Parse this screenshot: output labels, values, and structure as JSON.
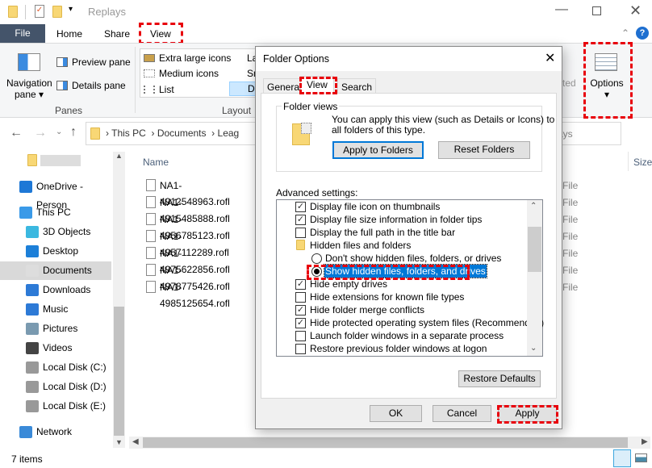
{
  "window": {
    "title": "Replays"
  },
  "ribbon": {
    "tabs": [
      "File",
      "Home",
      "Share",
      "View"
    ],
    "panes": {
      "navigation_pane": "Navigation",
      "navigation_pane2": "pane",
      "preview_pane": "Preview pane",
      "details_pane": "Details pane",
      "group_label": "Panes"
    },
    "layout": {
      "items": [
        "Extra large icons",
        "Medium icons",
        "List",
        "La",
        "Sm",
        "De"
      ],
      "group_label": "Layout"
    },
    "selected_fragment": "ted",
    "options": "Options"
  },
  "address": {
    "crumbs": [
      "This PC",
      "Documents",
      "Leag"
    ],
    "search_fragment": "ays"
  },
  "nav": {
    "items": [
      "OneDrive - Person",
      "This PC",
      "3D Objects",
      "Desktop",
      "Documents",
      "Downloads",
      "Music",
      "Pictures",
      "Videos",
      "Local Disk (C:)",
      "Local Disk (D:)",
      "Local Disk (E:)",
      "Network"
    ],
    "selected": "Documents"
  },
  "files": {
    "header_name": "Name",
    "header_size": "Size",
    "type_fragment": "File",
    "items": [
      "NA1-4912548963.rofl",
      "NA1-4915485888.rofl",
      "NA1-4956785123.rofl",
      "NA1-4957112289.rofl",
      "NA1-4975622856.rofl",
      "NA1-4978775426.rofl",
      "NA1-4985125654.rofl"
    ]
  },
  "status": {
    "count": "7 items"
  },
  "dialog": {
    "title": "Folder Options",
    "tabs": [
      "General",
      "View",
      "Search"
    ],
    "active_tab": "View",
    "folder_views": {
      "label": "Folder views",
      "text1": "You can apply this view (such as Details or Icons) to",
      "text2": "all folders of this type.",
      "apply": "Apply to Folders",
      "reset": "Reset Folders"
    },
    "advanced_label": "Advanced settings:",
    "settings": [
      {
        "label": "Display file icon on thumbnails",
        "type": "check",
        "checked": true
      },
      {
        "label": "Display file size information in folder tips",
        "type": "check",
        "checked": true
      },
      {
        "label": "Display the full path in the title bar",
        "type": "check",
        "checked": false
      },
      {
        "label": "Hidden files and folders",
        "type": "folder"
      },
      {
        "label": "Don't show hidden files, folders, or drives",
        "type": "radio",
        "checked": false
      },
      {
        "label": "Show hidden files, folders, and drives",
        "type": "radio",
        "checked": true
      },
      {
        "label": "Hide empty drives",
        "type": "check",
        "checked": true
      },
      {
        "label": "Hide extensions for known file types",
        "type": "check",
        "checked": false
      },
      {
        "label": "Hide folder merge conflicts",
        "type": "check",
        "checked": true
      },
      {
        "label": "Hide protected operating system files (Recommended)",
        "type": "check",
        "checked": true
      },
      {
        "label": "Launch folder windows in a separate process",
        "type": "check",
        "checked": false
      },
      {
        "label": "Restore previous folder windows at logon",
        "type": "check",
        "checked": false
      }
    ],
    "restore_defaults": "Restore Defaults",
    "ok": "OK",
    "cancel": "Cancel",
    "apply": "Apply"
  },
  "colors": {
    "file_tab": "#44546a",
    "accent": "#0078d7",
    "highlight": "#e8000b",
    "selection": "#cce8ff"
  }
}
